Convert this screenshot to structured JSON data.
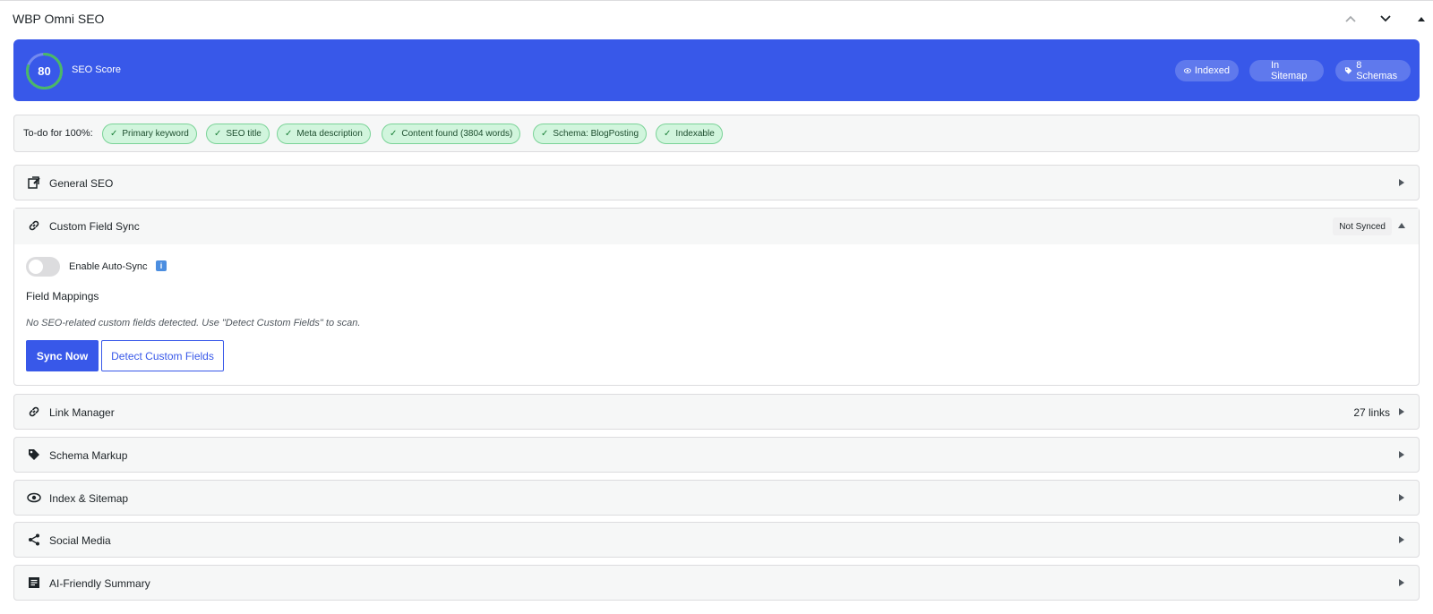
{
  "panel": {
    "title": "WBP Omni SEO"
  },
  "score": {
    "value": "80",
    "label": "SEO Score",
    "fraction": 0.8
  },
  "badges": {
    "indexed": "Indexed",
    "sitemap": "In Sitemap",
    "schemas": "8 Schemas"
  },
  "todo": {
    "label": "To-do for 100%:",
    "items": [
      "Primary keyword",
      "SEO title",
      "Meta description",
      "Content found (3804 words)",
      "Schema: BlogPosting",
      "Indexable"
    ]
  },
  "sections": {
    "general": {
      "title": "General SEO"
    },
    "custom_field_sync": {
      "title": "Custom Field Sync",
      "status": "Not Synced",
      "toggle_label": "Enable Auto-Sync",
      "toggle_on": false,
      "info_glyph": "i",
      "mappings_title": "Field Mappings",
      "mappings_note": "No SEO-related custom fields detected. Use \"Detect Custom Fields\" to scan.",
      "sync_button": "Sync Now",
      "detect_button": "Detect Custom Fields"
    },
    "link_manager": {
      "title": "Link Manager",
      "meta": "27 links"
    },
    "schema": {
      "title": "Schema Markup"
    },
    "index_sitemap": {
      "title": "Index & Sitemap"
    },
    "social": {
      "title": "Social Media"
    },
    "ai_summary": {
      "title": "AI-Friendly Summary"
    }
  },
  "colors": {
    "accent": "#3858e9",
    "score_ring": "#4ab866",
    "chip_bg": "#d1f5dd"
  }
}
